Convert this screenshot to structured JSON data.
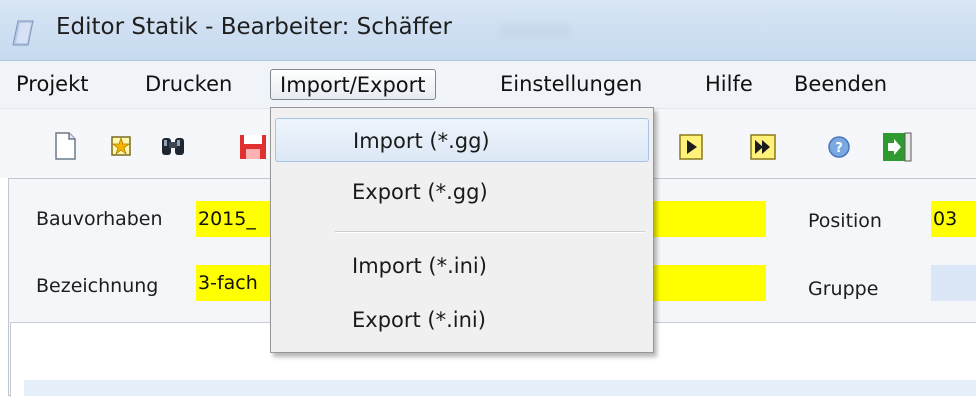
{
  "window": {
    "title": "Editor Statik - Bearbeiter: Schäffer"
  },
  "menubar": {
    "items": [
      {
        "label": "Projekt"
      },
      {
        "label": "Drucken"
      },
      {
        "label": "Import/Export",
        "active": true
      },
      {
        "label": "Einstellungen"
      },
      {
        "label": "Hilfe"
      },
      {
        "label": "Beenden"
      }
    ]
  },
  "dropdown": {
    "items": [
      {
        "label": "Import (*.gg)",
        "highlighted": true
      },
      {
        "label": "Export (*.gg)"
      },
      {
        "label": "Import (*.ini)"
      },
      {
        "label": "Export (*.ini)"
      }
    ]
  },
  "toolbar": {
    "icons": [
      "new-document-icon",
      "star-icon",
      "binoculars-icon",
      "save-icon",
      "play-icon",
      "fast-forward-icon",
      "help-icon",
      "exit-icon"
    ]
  },
  "form": {
    "bauvorhaben": {
      "label": "Bauvorhaben",
      "value": "2015_"
    },
    "bezeichnung": {
      "label": "Bezeichnung",
      "value": "3-fach"
    },
    "position": {
      "label": "Position",
      "value": "03"
    },
    "gruppe": {
      "label": "Gruppe",
      "value": ""
    }
  },
  "colors": {
    "field_highlight": "#ffff00",
    "menu_hover": "#dce8f6"
  }
}
